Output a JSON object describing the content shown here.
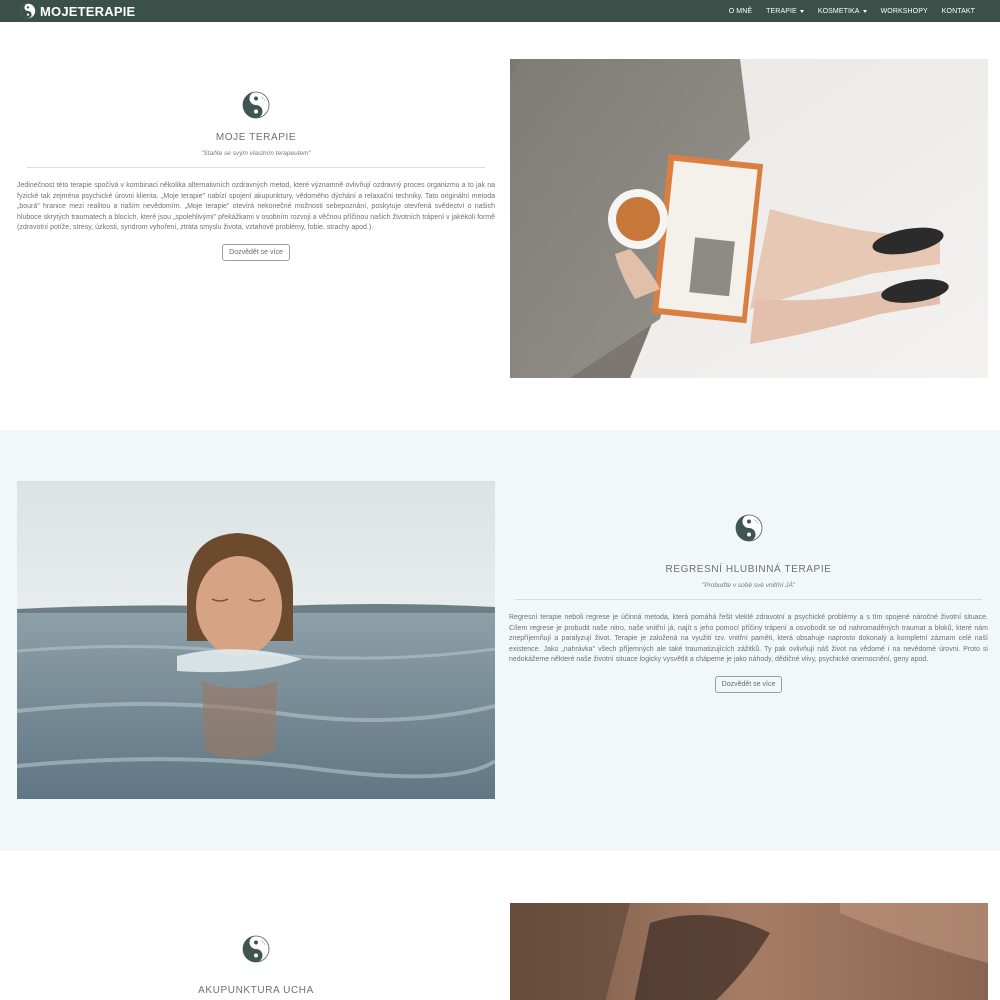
{
  "brand": {
    "name": "MOJETERAPIE",
    "icon": "yin-yang-logo-icon"
  },
  "nav": {
    "items": [
      {
        "label": "O MNĚ",
        "dropdown": false
      },
      {
        "label": "TERAPIE",
        "dropdown": true
      },
      {
        "label": "KOSMETIKA",
        "dropdown": true
      },
      {
        "label": "WORKSHOPY",
        "dropdown": false
      },
      {
        "label": "KONTAKT",
        "dropdown": false
      }
    ]
  },
  "sections": [
    {
      "icon": "yin-yang-icon",
      "title": "MOJE TERAPIE",
      "subtitle": "\"Staňte se svým vlastním terapeutem\"",
      "paragraph": "Jedinečnost této terapie spočívá v kombinaci několika alternativních ozdravných metod, které významně ovlivňují ozdravný proces organizmu a to jak na fyzické tak zejména psychické úrovni klienta. „Moje terapie\" nabízí spojení akupunktury, vědomého dýchání a relaxační techniky. Tato originální metoda „bourá\" hranice mezi realitou a riaším nevědomím. „Moje terapie\" otevírá nekonečné možnosti sebepoznání, poskytuje otevřená svědectví o našich hluboce skrytých traumatech a blocích, které jsou „spolehlivými\" překážkami v osobním rozvoji a věčnou příčinou našich životních trápení v jakékoli formě (zdravotní potíže, stresy, úzkosti, syndrom vyhoření, ztráta smyslu života, vztahové problémy, fobie, strachy apod.).",
      "button": "Dozvědět se více",
      "image": "woman-reading-book-with-tea-photo"
    },
    {
      "icon": "yin-yang-icon",
      "title": "REGRESNÍ HLUBINNÁ TERAPIE",
      "subtitle": "\"Probuďte v sobě své vnitřní JÁ\"",
      "paragraph": "Regresní terapie neboli regrese je účinná metoda, která pomáhá řešit vleklé zdravotní a psychické problémy a s tím spojené náročné životní situace. Cílem regrese je probudit naše nitro, naše vnitřní já, najít s jeho pomocí příčiny trápení a osvobodit se od nahromaděných traumat a bloků, které nám znepříjemňují a paralyzují život. Terapie je založená na využití tzv. vnitřní paměti, která obsahuje naprosto dokonalý a kompletní záznam celé naší existence. Jako „nahrávka\" všech příjemných ale také traumatizujících zážitků. Ty pak ovlivňují náš život na vědomé i na nevědomé úrovni. Proto si nedokážeme některé naše životní situace logicky vysvětlit a chápeme je jako náhody, dědičné vlivy, psychické onemocnění, geny apod.",
      "button": "Dozvědět se více",
      "image": "woman-swimming-in-lake-photo"
    },
    {
      "icon": "yin-yang-icon",
      "title": "AKUPUNKTURA UCHA",
      "image": "ear-acupuncture-photo"
    }
  ],
  "colors": {
    "navbar": "#3a5048",
    "section_alt_bg": "#f2f7f7",
    "text": "#727272"
  }
}
